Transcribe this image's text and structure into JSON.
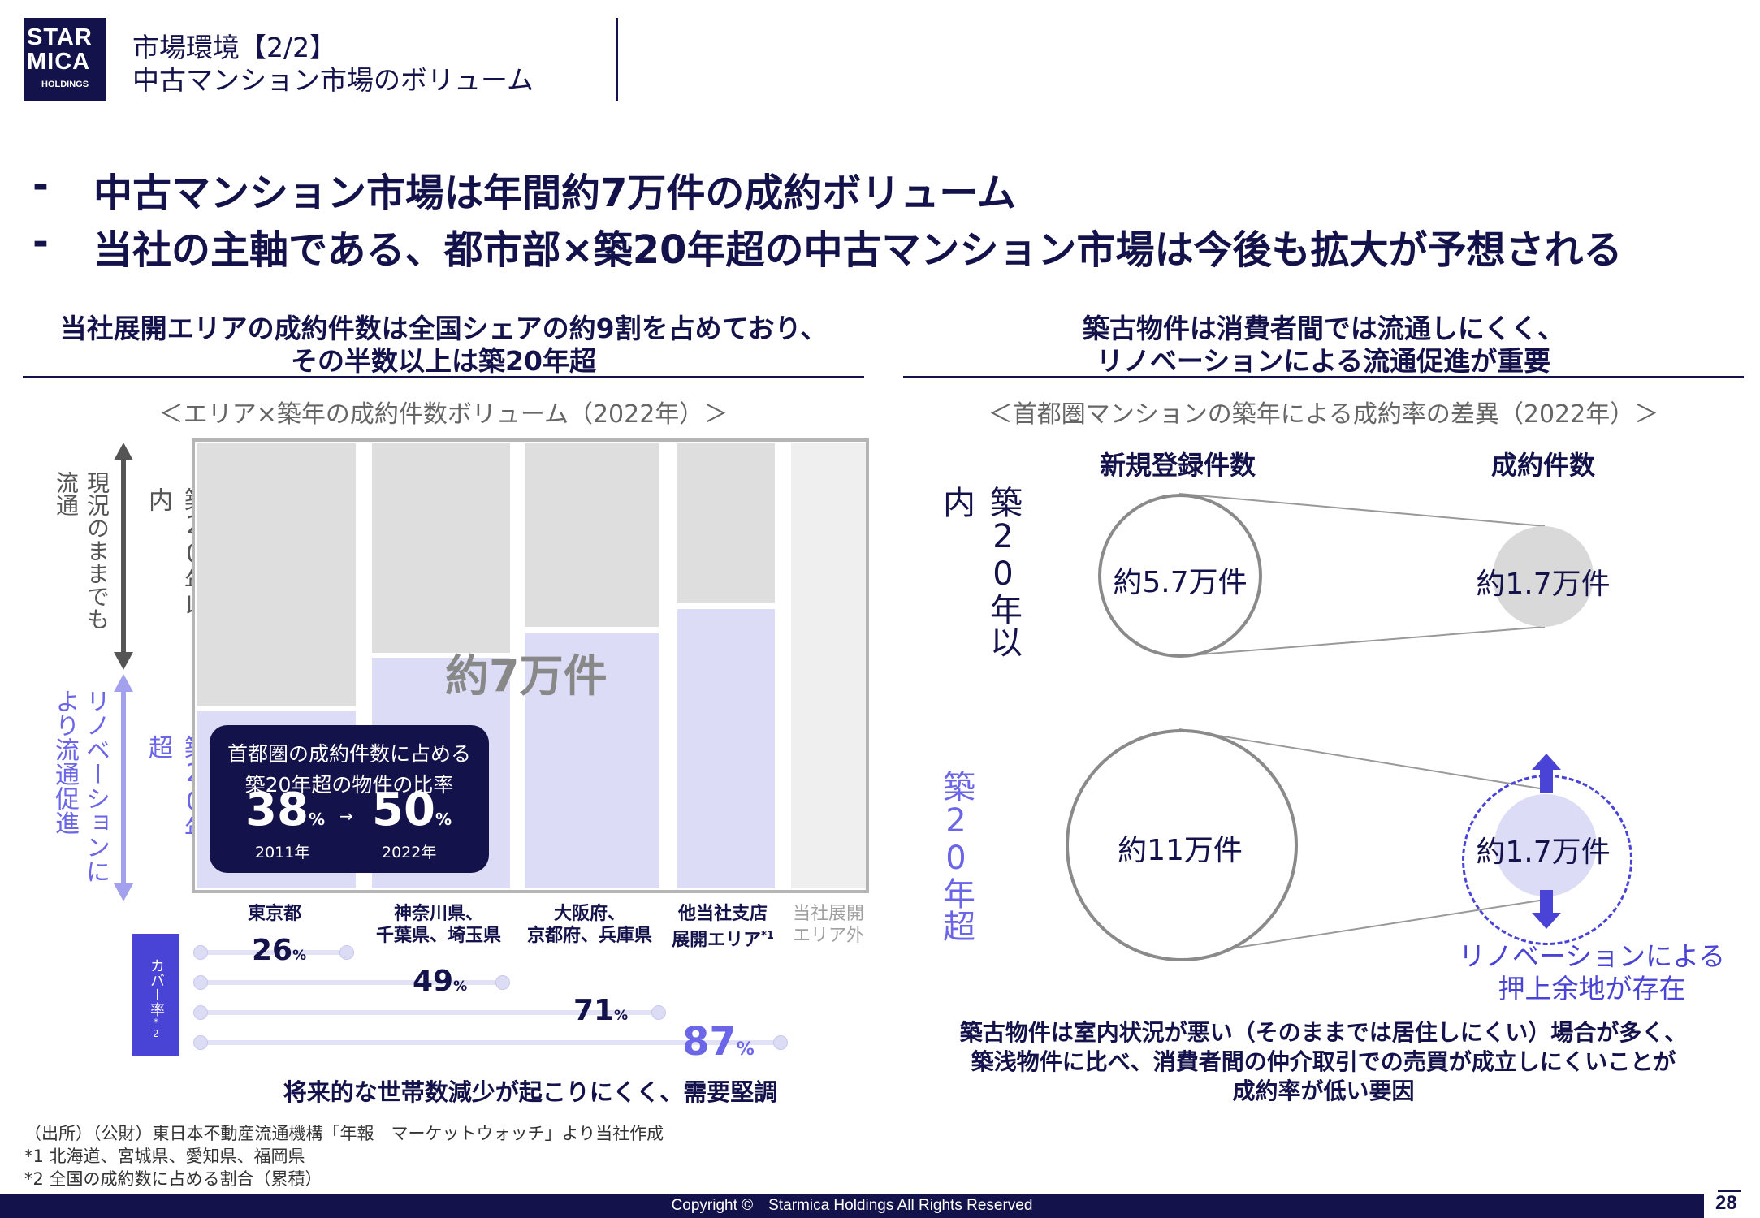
{
  "logo": {
    "line1": "STAR",
    "line2": "MICA",
    "line3": "HOLDINGS"
  },
  "header": {
    "title1": "市場環境【2/2】",
    "title2": "中古マンション市場のボリューム"
  },
  "bullets": [
    {
      "dash": "-",
      "text": "中古マンション市場は年間約7万件の成約ボリューム"
    },
    {
      "dash": "-",
      "text": "当社の主軸である、都市部×築20年超の中古マンション市場は今後も拡大が予想される"
    }
  ],
  "left": {
    "heading1": "当社展開エリアの成約件数は全国シェアの約9割を占めており、",
    "heading2": "その半数以上は築20年超",
    "chart_title": "＜エリア×築年の成約件数ボリューム（2022年）＞",
    "axis_top_outer": "現況のままでも流通",
    "axis_top_inner": "築20年以内",
    "axis_bottom_outer": "リノベーションにより流通促進",
    "axis_bottom_inner": "築20年超",
    "center_label": "約7万件",
    "callout": {
      "line1": "首都圏の成約件数に占める",
      "line2": "築20年超の物件の比率",
      "v1": "38",
      "v2": "50",
      "unit": "%",
      "arrow": "→",
      "y1": "2011年",
      "y2": "2022年"
    },
    "categories": [
      {
        "line1": "東京都",
        "line2": ""
      },
      {
        "line1": "神奈川県、",
        "line2": "千葉県、埼玉県"
      },
      {
        "line1": "大阪府、",
        "line2": "京都府、兵庫県"
      },
      {
        "line1": "他当社支店",
        "line2": "展開エリア",
        "note": "*1"
      },
      {
        "line1": "当社展開",
        "line2": "エリア外"
      }
    ],
    "cover_label": "カバー率",
    "cover_note": "*2",
    "cover": [
      {
        "value": "26",
        "unit": "%"
      },
      {
        "value": "49",
        "unit": "%"
      },
      {
        "value": "71",
        "unit": "%"
      },
      {
        "value": "87",
        "unit": "%"
      }
    ],
    "bottom_note": "将来的な世帯数減少が起こりにくく、需要堅調"
  },
  "right": {
    "heading1": "築古物件は消費者間では流通しにくく、",
    "heading2": "リノベーションによる流通促進が重要",
    "chart_title": "＜首都圏マンションの築年による成約率の差異（2022年）＞",
    "col1": "新規登録件数",
    "col2": "成約件数",
    "row1_label": "築20年以内",
    "row2_label": "築20年超",
    "row1_reg": "約5.7万件",
    "row1_deal": "約1.7万件",
    "row2_reg": "約11万件",
    "row2_deal": "約1.7万件",
    "reno1": "リノベーションによる",
    "reno2": "押上余地が存在",
    "desc1": "築古物件は室内状況が悪い（そのままでは居住しにくい）場合が多く、",
    "desc2": "築浅物件に比べ、消費者間の仲介取引での売買が成立しにくいことが",
    "desc3": "成約率が低い要因"
  },
  "sources": {
    "line1": "（出所）（公財）東日本不動産流通機構「年報　マーケットウォッチ」より当社作成",
    "line2": "*1 北海道、宮城県、愛知県、福岡県",
    "line3": "*2 全国の成約数に占める割合（累積）"
  },
  "footer": {
    "copyright": "Copyright ©　Starmica Holdings All Rights Reserved",
    "page": "28"
  }
}
